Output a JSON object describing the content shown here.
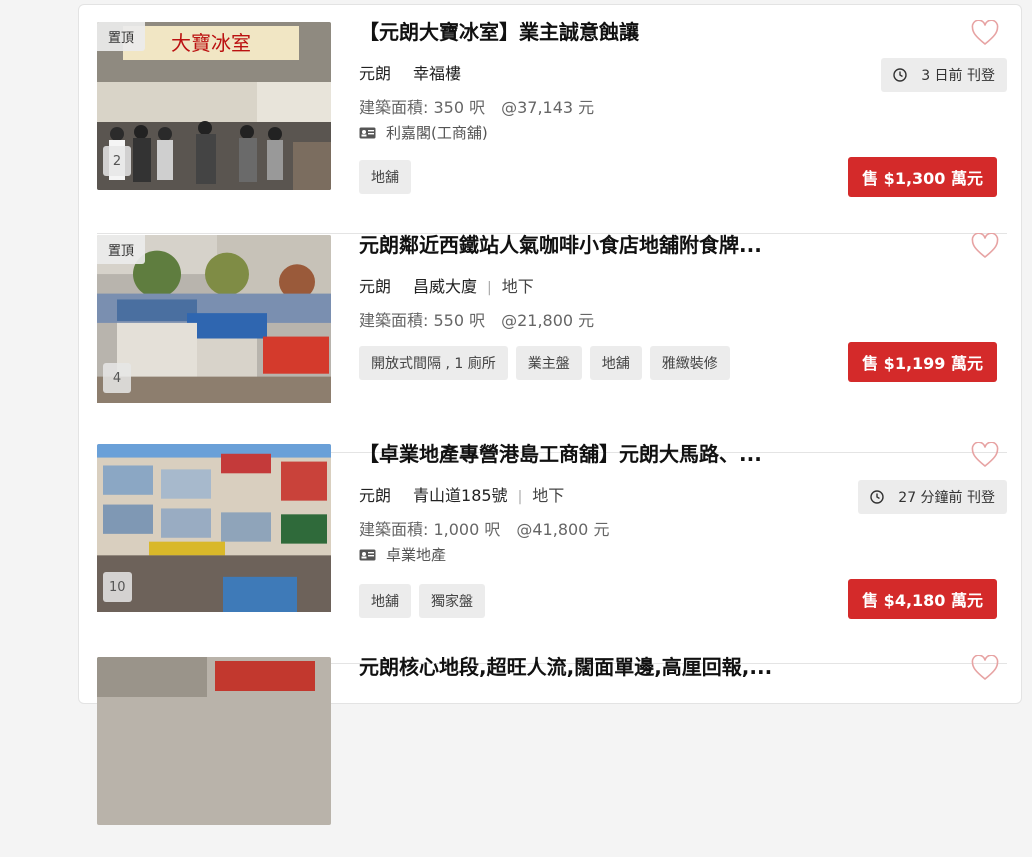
{
  "listings": [
    {
      "pinned_label": "置頂",
      "photo_count": "2",
      "title": "【元朗大寶冰室】業主誠意蝕讓",
      "district": "元朗",
      "estate": "幸福樓",
      "floor": "",
      "area": "建築面積: 350 呎",
      "price_per_ft": "@37,143 元",
      "agent": "利嘉閣(工商舖)",
      "posted": "3 日前 刊登",
      "tags": [
        "地舖"
      ],
      "price": "售 $1,300 萬元"
    },
    {
      "pinned_label": "置頂",
      "photo_count": "4",
      "title": "元朗鄰近西鐵站人氣咖啡小食店地舖附食牌...",
      "district": "元朗",
      "estate": "昌威大廈",
      "floor": "地下",
      "area": "建築面積: 550 呎",
      "price_per_ft": "@21,800 元",
      "agent": "",
      "posted": "",
      "tags": [
        "開放式間隔 , 1 廁所",
        "業主盤",
        "地舖",
        "雅緻裝修"
      ],
      "price": "售 $1,199 萬元"
    },
    {
      "pinned_label": "",
      "photo_count": "10",
      "title": "【卓業地產專營港島工商舖】元朗大馬路、...",
      "district": "元朗",
      "estate": "青山道185號",
      "floor": "地下",
      "area": "建築面積: 1,000 呎",
      "price_per_ft": "@41,800 元",
      "agent": "卓業地產",
      "posted": "27 分鐘前 刊登",
      "tags": [
        "地舖",
        "獨家盤"
      ],
      "price": "售 $4,180 萬元"
    },
    {
      "title": "元朗核心地段,超旺人流,闊面單邊,高厘回報,..."
    }
  ],
  "colors": {
    "accent_red": "#d42a2a",
    "tag_bg": "#ececec"
  },
  "icons": {
    "favorite": "heart-outline-icon",
    "clock": "clock-icon",
    "agent": "id-card-icon"
  }
}
